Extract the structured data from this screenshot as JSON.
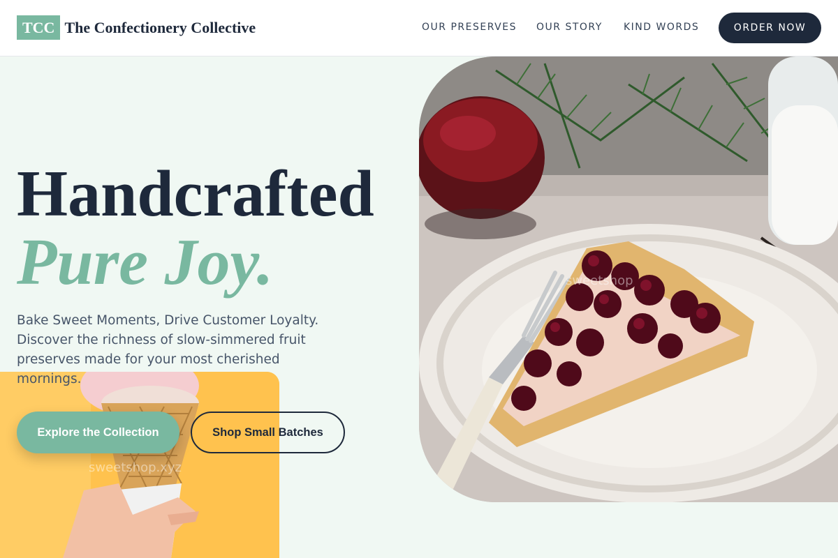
{
  "header": {
    "logo_badge": "TCC",
    "logo_text": "The Confectionery Collective",
    "nav": [
      "OUR PRESERVES",
      "OUR STORY",
      "KIND WORDS"
    ],
    "cta": "ORDER NOW"
  },
  "hero": {
    "headline_line1": "Handcrafted",
    "headline_line2": "Pure Joy.",
    "lead": "Bake Sweet Moments, Drive Customer Loyalty. Discover the richness of slow-simmered fruit preserves made for your most cherished mornings.",
    "primary_button": "Explore the Collection",
    "secondary_button": "Shop Small Batches"
  },
  "watermarks": {
    "cone": "sweetshop.xyz",
    "tart": "sweetshop"
  },
  "colors": {
    "accent": "#79b8a0",
    "dark": "#1e293b",
    "background": "#f0f8f3",
    "cone_background": "#ffc24e"
  },
  "images": {
    "hero_photo": "cherry tart slice with fork on ornate white plate, jam bowl, glass of milk",
    "cone_photo": "hand holding waffle ice cream cone on yellow background"
  }
}
